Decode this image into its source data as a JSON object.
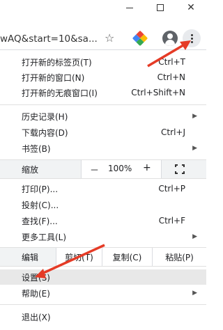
{
  "window": {
    "minimize_icon": "minimize-icon",
    "maximize_icon": "maximize-icon",
    "close_label": "✕"
  },
  "toolbar": {
    "url_text": "wAQ&start=10&sa...",
    "star_glyph": "☆",
    "extension_colors": [
      "#ea4335",
      "#fbbc05",
      "#34a853",
      "#4285f4"
    ]
  },
  "menu": {
    "new_tab": {
      "label": "打开新的标签页(T)",
      "shortcut": "Ctrl+T"
    },
    "new_window": {
      "label": "打开新的窗口(N)",
      "shortcut": "Ctrl+N"
    },
    "new_incognito": {
      "label": "打开新的无痕窗口(I)",
      "shortcut": "Ctrl+Shift+N"
    },
    "history": {
      "label": "历史记录(H)"
    },
    "downloads": {
      "label": "下载内容(D)",
      "shortcut": "Ctrl+J"
    },
    "bookmarks": {
      "label": "书签(B)"
    },
    "zoom": {
      "label": "缩放",
      "minus": "－",
      "value": "100%",
      "plus": "+"
    },
    "print": {
      "label": "打印(P)...",
      "shortcut": "Ctrl+P"
    },
    "cast": {
      "label": "投射(C)..."
    },
    "find": {
      "label": "查找(F)...",
      "shortcut": "Ctrl+F"
    },
    "more_tools": {
      "label": "更多工具(L)"
    },
    "edit": {
      "label": "编辑",
      "cut": "剪切(T)",
      "copy": "复制(C)",
      "paste": "粘贴(P)"
    },
    "settings": {
      "label": "设置(S)"
    },
    "help": {
      "label": "帮助(E)"
    },
    "exit": {
      "label": "退出(X)"
    },
    "submenu_glyph": "▶"
  },
  "annotation_color": "#e53b26"
}
